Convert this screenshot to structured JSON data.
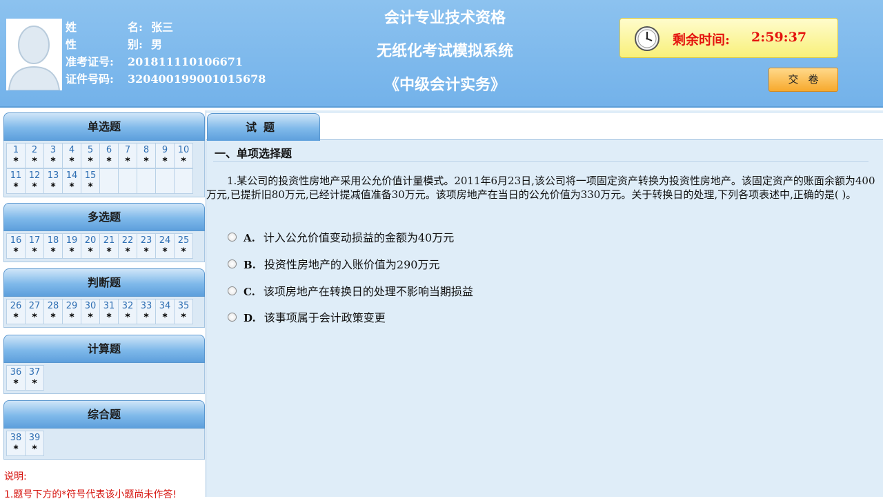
{
  "candidate": {
    "name_label": "姓        名:",
    "name_value": "张三",
    "gender_label": "性        别:",
    "gender_value": "男",
    "ticket_label": "准考证号:",
    "ticket_value": "201811110106671",
    "id_label": "证件号码:",
    "id_value": "320400199001015678"
  },
  "header": {
    "title_line1": "会计专业技术资格",
    "title_line2": "无纸化考试模拟系统",
    "title_line3": "《中级会计实务》",
    "timer_label": "剩余时间:",
    "timer_value": "2:59:37",
    "submit_label": "交卷"
  },
  "sections": [
    {
      "title": "单选题",
      "items": [
        "1",
        "2",
        "3",
        "4",
        "5",
        "6",
        "7",
        "8",
        "9",
        "10",
        "11",
        "12",
        "13",
        "14",
        "15"
      ]
    },
    {
      "title": "多选题",
      "items": [
        "16",
        "17",
        "18",
        "19",
        "20",
        "21",
        "22",
        "23",
        "24",
        "25"
      ]
    },
    {
      "title": "判断题",
      "items": [
        "26",
        "27",
        "28",
        "29",
        "30",
        "31",
        "32",
        "33",
        "34",
        "35"
      ]
    },
    {
      "title": "计算题",
      "items": [
        "36",
        "37"
      ]
    },
    {
      "title": "综合题",
      "items": [
        "38",
        "39"
      ]
    }
  ],
  "unanswered_mark": "*",
  "notes": {
    "title": "说明:",
    "line1": "1.题号下方的*符号代表该小题尚未作答!"
  },
  "main": {
    "tab_label": "试题",
    "section_title": "一、单项选择题",
    "question": "1.某公司的投资性房地产采用公允价值计量模式。2011年6月23日,该公司将一项固定资产转换为投资性房地产。该固定资产的账面余额为400万元,已提折旧80万元,已经计提减值准备30万元。该项房地产在当日的公允价值为330万元。关于转换日的处理,下列各项表述中,正确的是(      )。",
    "options": [
      {
        "letter": "A.",
        "text": "计入公允价值变动损益的金额为40万元"
      },
      {
        "letter": "B.",
        "text": "投资性房地产的入账价值为290万元"
      },
      {
        "letter": "C.",
        "text": "该项房地产在转换日的处理不影响当期损益"
      },
      {
        "letter": "D.",
        "text": "该事项属于会计政策变更"
      }
    ]
  }
}
